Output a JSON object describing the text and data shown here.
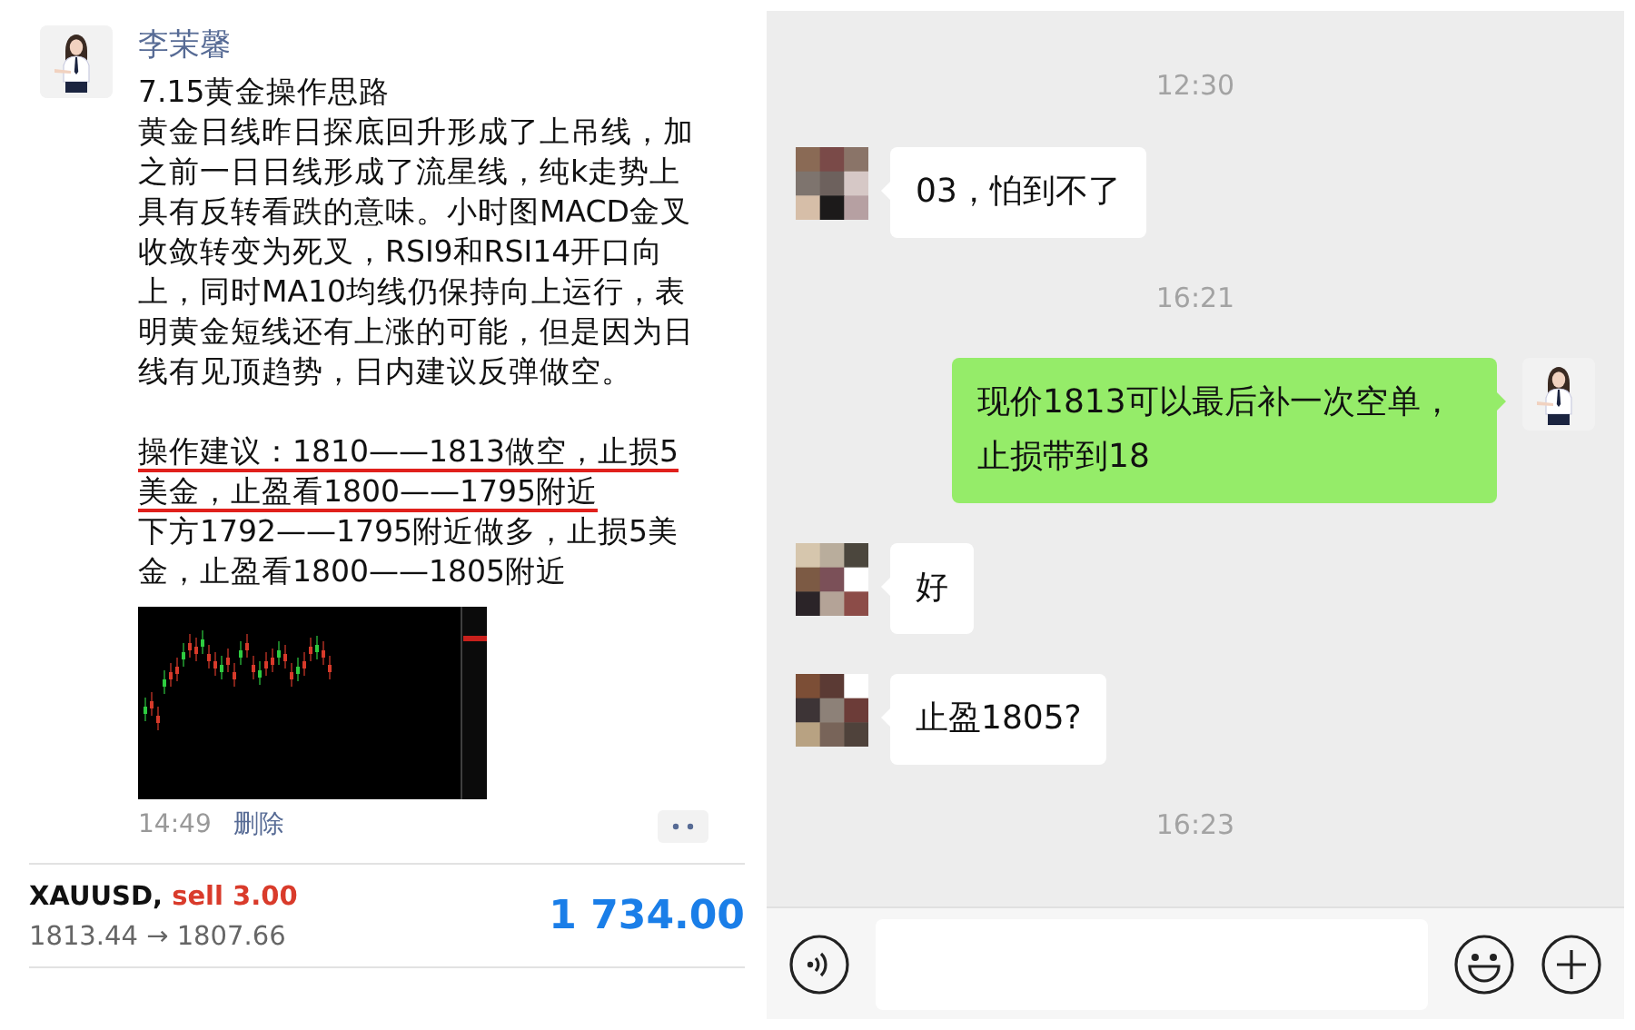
{
  "moment": {
    "author": "李茉馨",
    "paragraphs": [
      {
        "text": "7.15黄金操作思路",
        "underlined": false
      },
      {
        "text": "黄金日线昨日探底回升形成了上吊线，加之前一日日线形成了流星线，纯k走势上具有反转看跌的意味。小时图MACD金叉收敛转变为死叉，RSI9和RSI14开口向上，同时MA10均线仍保持向上运行，表明黄金短线还有上涨的可能，但是因为日线有见顶趋势，日内建议反弹做空。",
        "underlined": false
      },
      {
        "text": "操作建议：1810——1813做空，止损5美金，止盈看1800——1795附近",
        "underlined": true
      },
      {
        "text": "下方1792——1795附近做多，止损5美金，止盈看1800——1805附近",
        "underlined": false
      }
    ],
    "time": "14:49",
    "delete": "删除"
  },
  "trade": {
    "symbol": "XAUUSD,",
    "side": "sell 3.00",
    "prices": "1813.44 → 1807.66",
    "profit": "1 734.00"
  },
  "chat": {
    "messages": [
      {
        "kind": "time",
        "text": "12:30"
      },
      {
        "kind": "incoming",
        "text": "03，怕到不了"
      },
      {
        "kind": "time",
        "text": "16:21"
      },
      {
        "kind": "outgoing",
        "text": "现价1813可以最后补一次空单，止损带到18"
      },
      {
        "kind": "incoming",
        "text": "好"
      },
      {
        "kind": "incoming",
        "text": "止盈1805?"
      },
      {
        "kind": "time",
        "text": "16:23"
      }
    ]
  }
}
